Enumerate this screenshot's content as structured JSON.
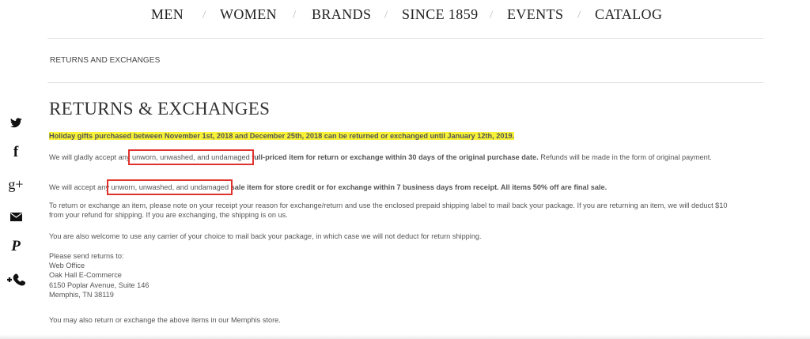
{
  "nav": {
    "items": [
      "MEN",
      "WOMEN",
      "BRANDS",
      "SINCE 1859",
      "EVENTS",
      "CATALOG"
    ],
    "separator": "/"
  },
  "breadcrumb": "RETURNS AND EXCHANGES",
  "page_title": "RETURNS & EXCHANGES",
  "holiday_notice": "Holiday gifts purchased between November 1st, 2018 and December 25th, 2018 can be returned or exchanged until January 12th, 2019.",
  "regular_policy": {
    "prefix": "We will gladly accept any ",
    "boxed": "unworn, unwashed, and undamaged",
    "bold": " full-priced item for return or exchange within 30 days of the original purchase date.",
    "suffix": " Refunds will be made in the form of original payment."
  },
  "sale_policy": {
    "prefix": "We will accept any ",
    "boxed": "unworn, unwashed, and undamaged",
    "bold": " sale item for store credit or for exchange within 7 business days from receipt. All items 50% off are final sale."
  },
  "return_instructions": "To return or exchange an item, please note on your receipt your reason for exchange/return and use the enclosed prepaid shipping label to mail back your package. If you are returning an item, we will deduct $10 from your refund for shipping. If you are exchanging, the shipping is on us.",
  "carrier_note": "You are also welcome to use any carrier of your choice to mail back your package, in which case we will not deduct for return shipping.",
  "address": {
    "intro": "Please send returns to:",
    "line1": "Web Office",
    "line2": "Oak Hall E-Commerce",
    "line3": "6150 Poplar Avenue, Suite 146",
    "line4": "Memphis, TN 38119"
  },
  "memphis_note": "You may also return or exchange the above items in our Memphis store.",
  "social": {
    "icons": [
      "twitter-icon",
      "facebook-icon",
      "google-plus-icon",
      "email-icon",
      "pinterest-icon",
      "add-contact-icon"
    ],
    "glyphs": {
      "facebook": "f",
      "google_plus": "g+",
      "pinterest": "P"
    }
  },
  "colors": {
    "highlight": "#f7f238",
    "annotation_box": "#e0332e",
    "text": "#555555",
    "nav_text": "#222222"
  }
}
